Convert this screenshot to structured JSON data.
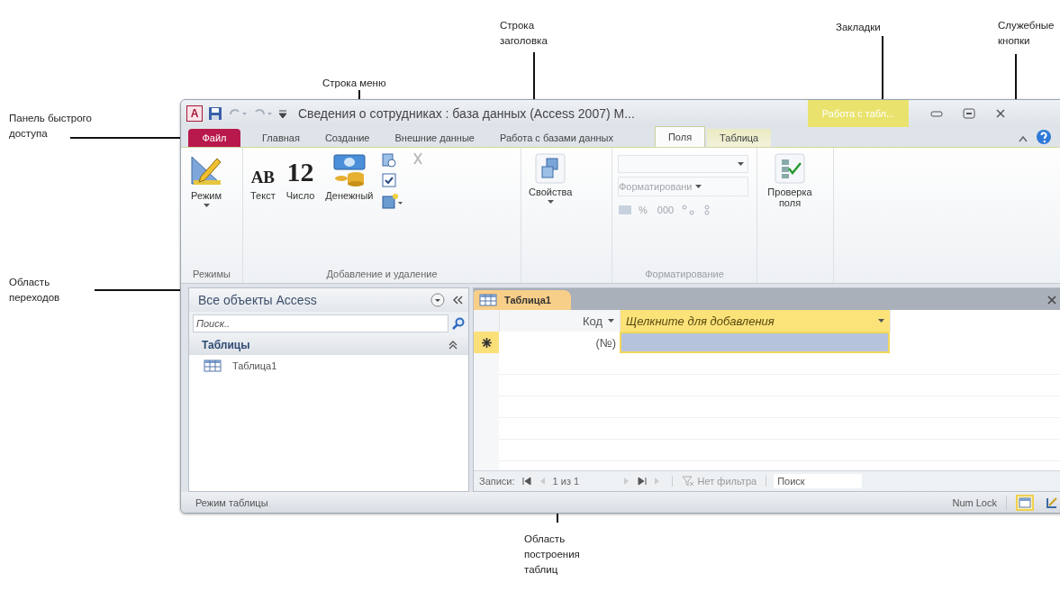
{
  "callouts": [
    {
      "text": "Строка заголовка"
    },
    {
      "text": "Закладки"
    },
    {
      "text": "Служебные кнопки"
    },
    {
      "text": "Строка меню"
    },
    {
      "text": "Панель быстрого доступа"
    },
    {
      "text": "Область переходов"
    },
    {
      "text": "Область построения таблиц"
    }
  ],
  "window": {
    "app_logo": "A",
    "title": "Сведения о сотрудниках : база данных (Access 2007) M...",
    "contextual_tab_group": "Работа с табл...",
    "tabs": [
      {
        "label": "Файл",
        "kind": "file",
        "selected": false
      },
      {
        "label": "Главная",
        "kind": "normal",
        "selected": false
      },
      {
        "label": "Создание",
        "kind": "normal",
        "selected": false
      },
      {
        "label": "Внешние данные",
        "kind": "normal",
        "selected": false
      },
      {
        "label": "Работа с базами данных",
        "kind": "normal",
        "selected": false
      },
      {
        "label": "Поля",
        "kind": "contextual",
        "selected": true
      },
      {
        "label": "Таблица",
        "kind": "contextual",
        "selected": false
      }
    ],
    "ribbon": {
      "groups": [
        {
          "kind": "views",
          "label": "Режимы",
          "buttons": [
            {
              "label": "Режим",
              "kind": "view"
            }
          ]
        },
        {
          "kind": "add_delete",
          "label": "Добавление и удаление",
          "buttons": [
            {
              "label": "Текст",
              "kind": "text",
              "glyph": "AB"
            },
            {
              "label": "Число",
              "kind": "number",
              "glyph": "12"
            },
            {
              "label": "Денежный",
              "kind": "currency"
            }
          ]
        },
        {
          "kind": "properties",
          "buttons": [
            {
              "label": "Свойства",
              "kind": "properties"
            }
          ]
        },
        {
          "kind": "formatting",
          "label": "Форматирование",
          "disabled": true,
          "format_dropdown": "Форматировани",
          "symbols": [
            "%",
            "000"
          ]
        },
        {
          "kind": "validation",
          "buttons": [
            {
              "label": "Проверка поля",
              "kind": "validation"
            }
          ]
        }
      ]
    },
    "nav_pane": {
      "title": "Все объекты Access",
      "search_placeholder": "Поиск..",
      "groups": [
        {
          "label": "Таблицы",
          "expanded": true,
          "items": [
            {
              "label": "Таблица1"
            }
          ]
        }
      ]
    },
    "document_tabs": [
      {
        "label": "Таблица1",
        "selected": true
      }
    ],
    "datasheet": {
      "columns": [
        {
          "label": "Код",
          "kind": "field",
          "selected": false
        },
        {
          "label": "Щелкните для добавления",
          "kind": "add",
          "selected": true
        }
      ],
      "new_row": {
        "id_placeholder": "(№)"
      }
    },
    "record_nav": {
      "label": "Записи:",
      "position": "1 из 1",
      "filter": "Нет фильтра",
      "search_placeholder": "Поиск"
    },
    "status_bar": {
      "text": "Режим таблицы",
      "indicators": [
        "Num Lock"
      ],
      "views": [
        {
          "kind": "datasheet",
          "selected": true
        },
        {
          "kind": "design",
          "selected": false
        }
      ]
    }
  }
}
